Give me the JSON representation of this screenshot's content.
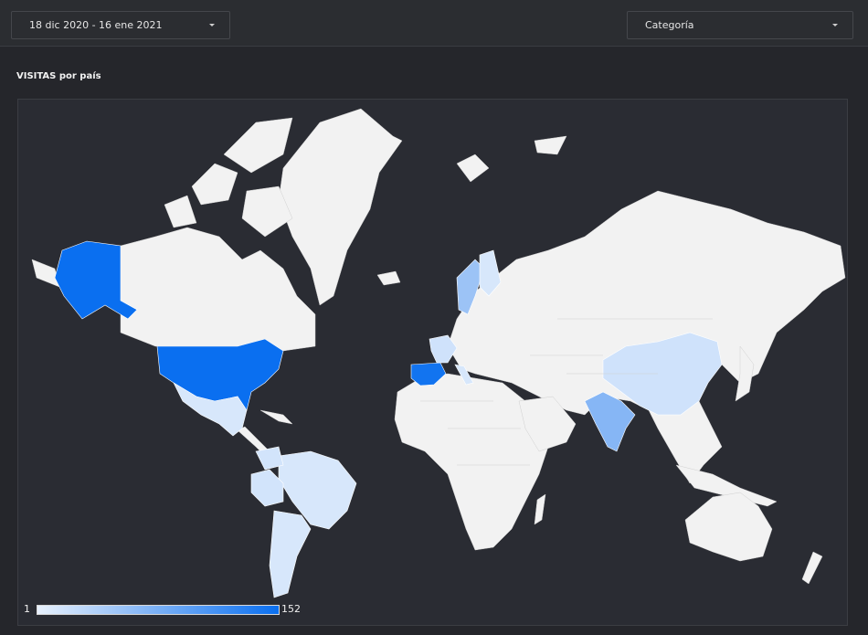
{
  "filters": {
    "date_range": "18 dic 2020 - 16 ene 2021",
    "category": "Categoría"
  },
  "section": {
    "title": "VISITAS por país"
  },
  "map": {
    "legend_min": "1",
    "legend_max": "152",
    "color_low": "#e8f1fd",
    "color_high": "#0a6ff0",
    "land_color": "#f2f2f2",
    "water_color": "#2a2c33",
    "highlighted_countries": [
      {
        "name": "United States",
        "level": 1.0
      },
      {
        "name": "Spain",
        "level": 0.9
      },
      {
        "name": "India",
        "level": 0.35
      },
      {
        "name": "Sweden",
        "level": 0.25
      },
      {
        "name": "France",
        "level": 0.15
      },
      {
        "name": "Italy",
        "level": 0.15
      },
      {
        "name": "China",
        "level": 0.15
      },
      {
        "name": "Mexico",
        "level": 0.1
      },
      {
        "name": "Brazil",
        "level": 0.1
      },
      {
        "name": "Argentina",
        "level": 0.1
      },
      {
        "name": "Colombia",
        "level": 0.1
      },
      {
        "name": "Peru",
        "level": 0.1
      },
      {
        "name": "Chile",
        "level": 0.1
      }
    ]
  }
}
